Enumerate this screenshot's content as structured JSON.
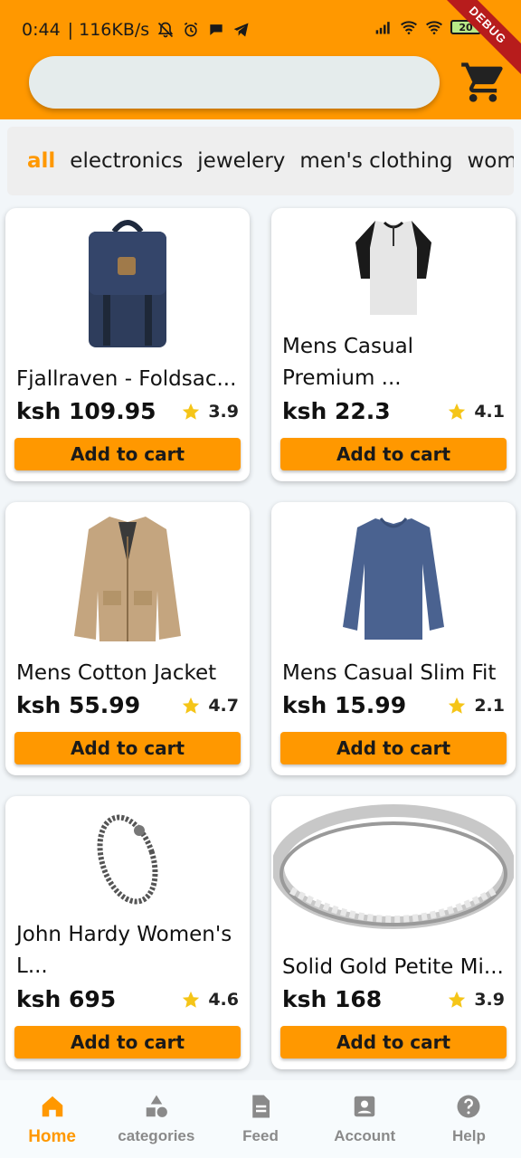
{
  "status_bar": {
    "time": "0:44",
    "speed": "| 116KB/s",
    "battery": "20",
    "debug": "DEBUG"
  },
  "search": {
    "placeholder": ""
  },
  "categories": [
    "all",
    "electronics",
    "jewelery",
    "men's clothing",
    "women's"
  ],
  "products": [
    {
      "title": "Fjallraven - Foldsac...",
      "price": "ksh 109.95",
      "rating": "3.9",
      "button": "Add to cart"
    },
    {
      "title": "Mens Casual Premium ...",
      "price": "ksh 22.3",
      "rating": "4.1",
      "button": "Add to cart"
    },
    {
      "title": "Mens Cotton Jacket",
      "price": "ksh 55.99",
      "rating": "4.7",
      "button": "Add to cart"
    },
    {
      "title": "Mens Casual Slim Fit",
      "price": "ksh 15.99",
      "rating": "2.1",
      "button": "Add to cart"
    },
    {
      "title": "John Hardy Women's L...",
      "price": "ksh 695",
      "rating": "4.6",
      "button": "Add to cart"
    },
    {
      "title": "Solid Gold Petite Mi...",
      "price": "ksh 168",
      "rating": "3.9",
      "button": "Add to cart"
    }
  ],
  "nav": [
    {
      "label": "Home",
      "icon": "home-icon"
    },
    {
      "label": "categories",
      "icon": "categories-icon"
    },
    {
      "label": "Feed",
      "icon": "feed-icon"
    },
    {
      "label": "Account",
      "icon": "account-icon"
    },
    {
      "label": "Help",
      "icon": "help-icon"
    }
  ],
  "colors": {
    "accent": "#ff9800",
    "star": "#f5c518",
    "muted": "#8a8a8a"
  }
}
